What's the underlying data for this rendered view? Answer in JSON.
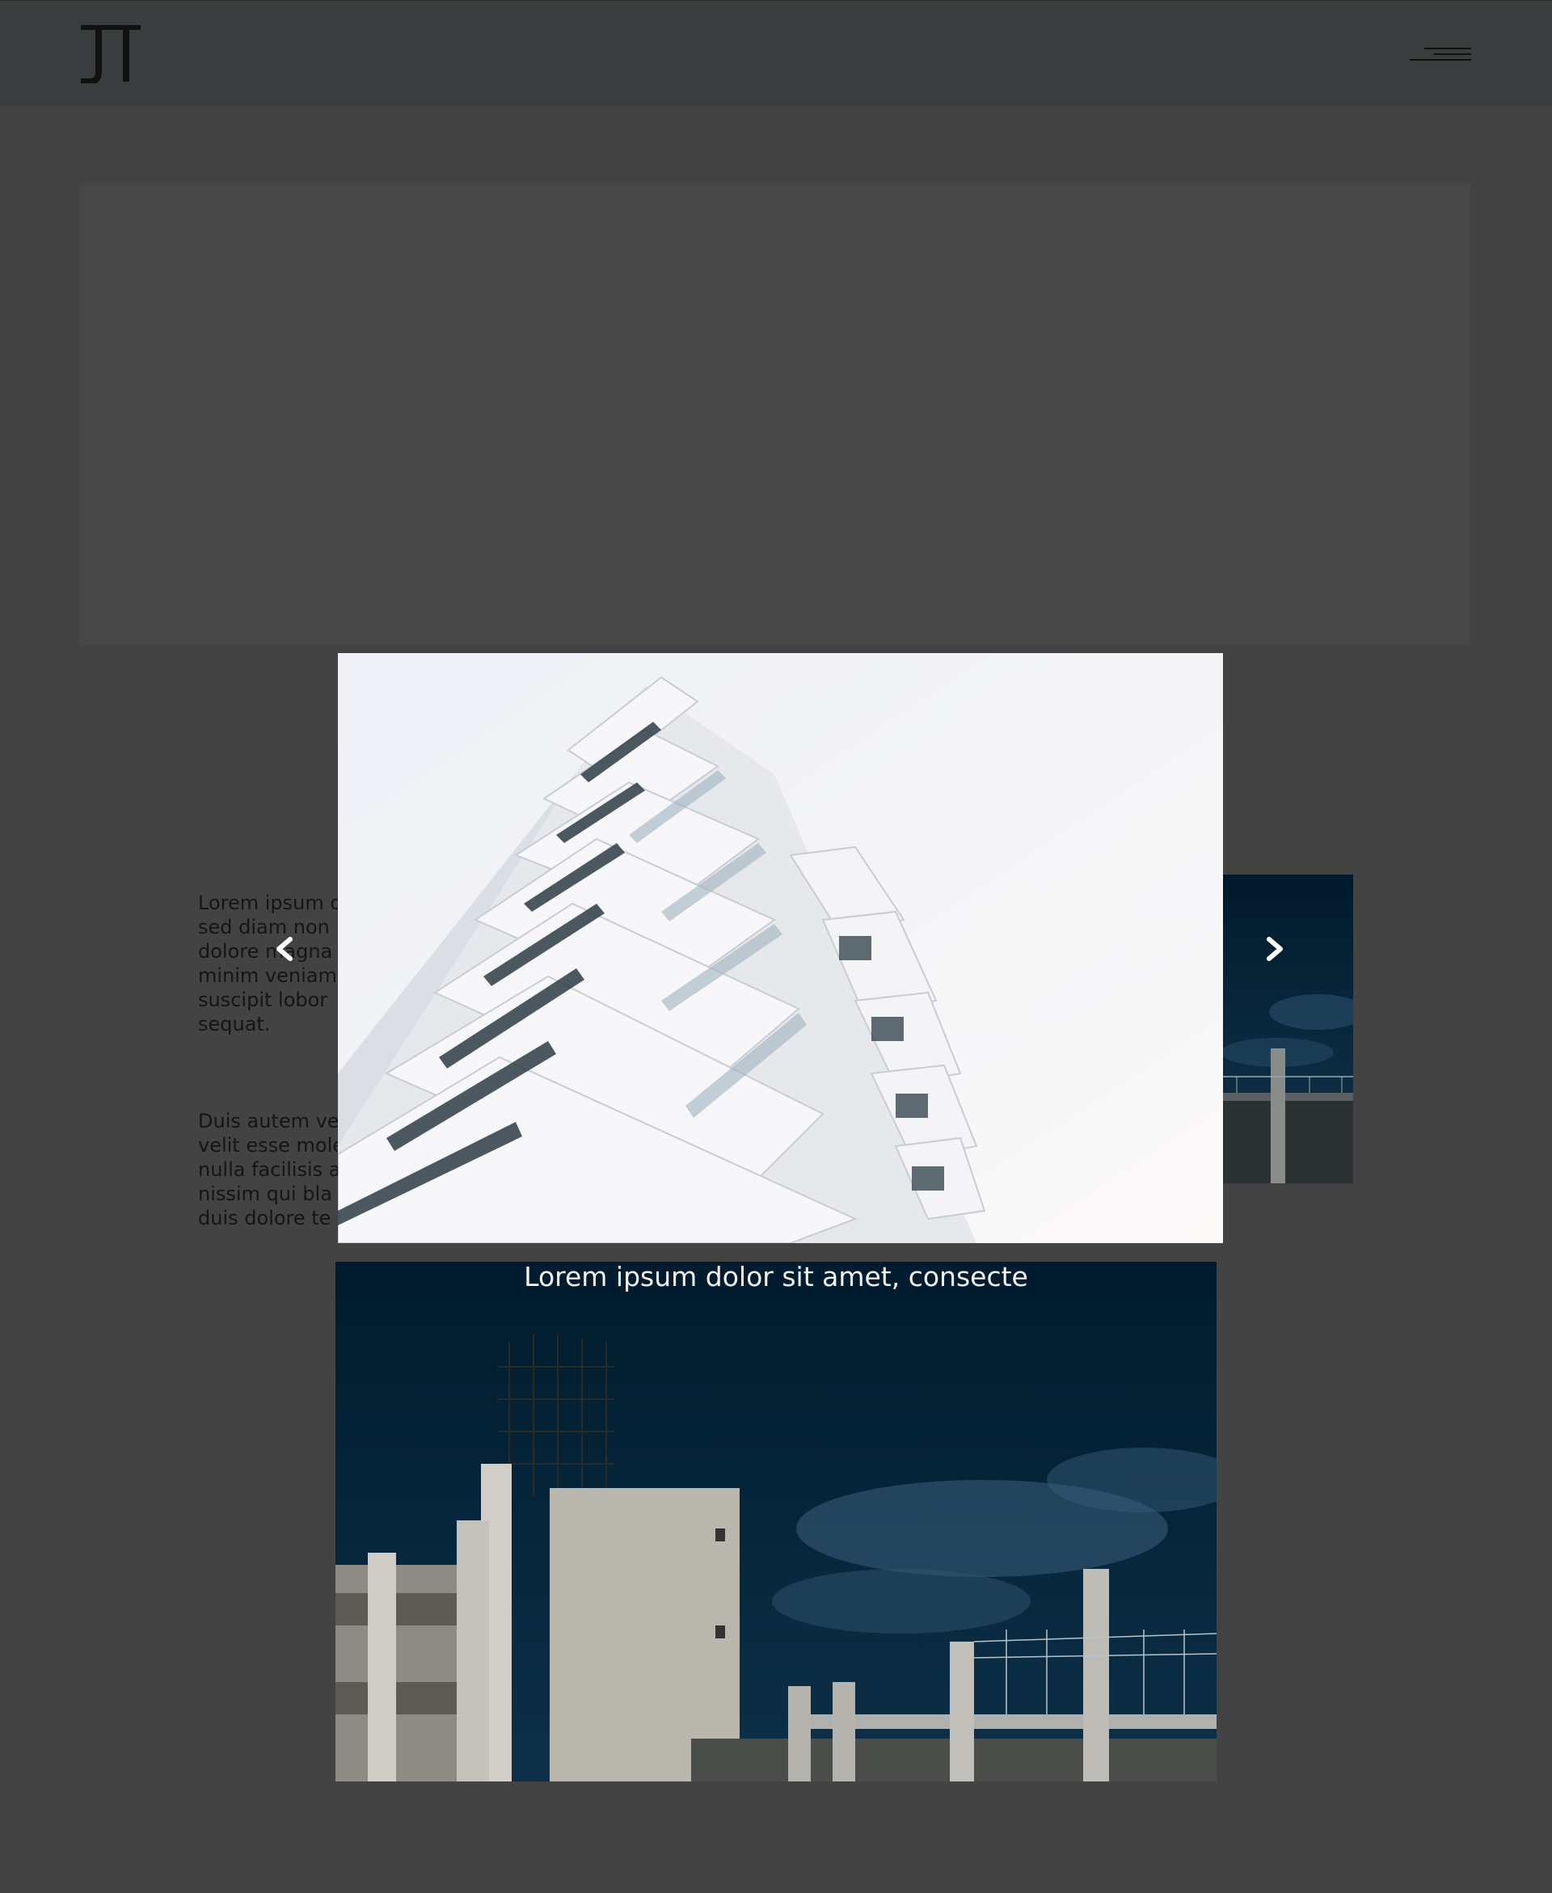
{
  "header": {
    "logo_text": "JT",
    "menu_icon": "hamburger-menu-icon"
  },
  "content": {
    "paragraph_1": "Lorem ipsum d\nsed diam non\ndolore magna\nminim veniam\nsuscipit lobor\nsequat.",
    "paragraph_2": "Duis autem ve\nvelit esse mole\nnulla facilisis a\nnissim qui bla\nduis dolore te"
  },
  "lightbox": {
    "prev_icon": "chevron-left-icon",
    "next_icon": "chevron-right-icon",
    "caption": "Lorem ipsum dolor sit amet, consecte"
  },
  "colors": {
    "overlay_background": "#434343",
    "header_background": "#3a3d3d",
    "text": "#151515",
    "caption": "#f2f2f2"
  }
}
